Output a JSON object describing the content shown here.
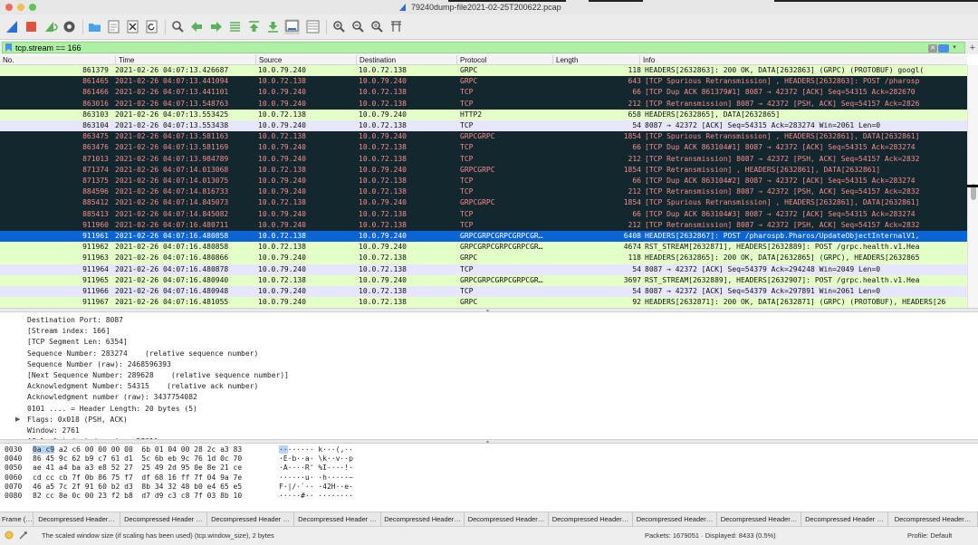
{
  "window": {
    "title": "79240dump-file2021-02-25T200622.pcap"
  },
  "toolbar": {
    "buttons": [
      "shark-fin-start-icon",
      "stop-icon",
      "restart-icon",
      "options-gear-icon",
      "open-folder-icon",
      "save-file-icon",
      "close-file-icon",
      "reload-icon",
      "find-magnifier-icon",
      "go-back-icon",
      "go-forward-icon",
      "go-to-packet-icon",
      "go-first-icon",
      "go-last-icon",
      "autoscroll-icon",
      "colorize-icon",
      "zoom-in-icon",
      "zoom-out-icon",
      "zoom-normal-icon",
      "resize-columns-icon"
    ]
  },
  "filter": {
    "value": "tcp.stream == 166",
    "clear_label": "✕",
    "plus_label": "+"
  },
  "packet_list": {
    "columns": [
      "No.",
      "Time",
      "Source",
      "Destination",
      "Protocol",
      "Length",
      "Info"
    ],
    "rows": [
      {
        "no": "861379",
        "time": "2021-02-26 04:07:13.426687",
        "src": "10.0.79.240",
        "dst": "10.0.72.138",
        "proto": "GRPC",
        "len": "118",
        "info": "HEADERS[2632863]: 200 OK, DATA[2632863] (GRPC) (PROTOBUF) googl(",
        "style": "green"
      },
      {
        "no": "861465",
        "time": "2021-02-26 04:07:13.441094",
        "src": "10.0.72.138",
        "dst": "10.0.79.240",
        "proto": "GRPC",
        "len": "643",
        "info": "[TCP Spurious Retransmission] , HEADERS[2632863]: POST /pharosp",
        "style": "dark"
      },
      {
        "no": "861466",
        "time": "2021-02-26 04:07:13.441101",
        "src": "10.0.79.240",
        "dst": "10.0.72.138",
        "proto": "TCP",
        "len": "66",
        "info": "[TCP Dup ACK 861379#1] 8087 → 42372 [ACK] Seq=54315 Ack=282670",
        "style": "dark"
      },
      {
        "no": "863016",
        "time": "2021-02-26 04:07:13.548763",
        "src": "10.0.79.240",
        "dst": "10.0.72.138",
        "proto": "TCP",
        "len": "212",
        "info": "[TCP Retransmission] 8087 → 42372 [PSH, ACK] Seq=54157 Ack=2826",
        "style": "dark"
      },
      {
        "no": "863103",
        "time": "2021-02-26 04:07:13.553425",
        "src": "10.0.72.138",
        "dst": "10.0.79.240",
        "proto": "HTTP2",
        "len": "658",
        "info": "HEADERS[2632865], DATA[2632865]",
        "style": "green"
      },
      {
        "no": "863104",
        "time": "2021-02-26 04:07:13.553438",
        "src": "10.0.79.240",
        "dst": "10.0.72.138",
        "proto": "TCP",
        "len": "54",
        "info": "8087 → 42372 [ACK] Seq=54315 Ack=283274 Win=2061 Len=0",
        "style": "lav"
      },
      {
        "no": "863475",
        "time": "2021-02-26 04:07:13.581163",
        "src": "10.0.72.138",
        "dst": "10.0.79.240",
        "proto": "GRPCGRPC",
        "len": "1854",
        "info": "[TCP Spurious Retransmission] , HEADERS[2632861], DATA[2632861]",
        "style": "dark"
      },
      {
        "no": "863476",
        "time": "2021-02-26 04:07:13.581169",
        "src": "10.0.79.240",
        "dst": "10.0.72.138",
        "proto": "TCP",
        "len": "66",
        "info": "[TCP Dup ACK 863104#1] 8087 → 42372 [ACK] Seq=54315 Ack=283274",
        "style": "dark"
      },
      {
        "no": "871013",
        "time": "2021-02-26 04:07:13.984789",
        "src": "10.0.79.240",
        "dst": "10.0.72.138",
        "proto": "TCP",
        "len": "212",
        "info": "[TCP Retransmission] 8087 → 42372 [PSH, ACK] Seq=54157 Ack=2832",
        "style": "dark"
      },
      {
        "no": "871374",
        "time": "2021-02-26 04:07:14.013068",
        "src": "10.0.72.138",
        "dst": "10.0.79.240",
        "proto": "GRPCGRPC",
        "len": "1854",
        "info": "[TCP Retransmission] , HEADERS[2632861], DATA[2632861]",
        "style": "dark"
      },
      {
        "no": "871375",
        "time": "2021-02-26 04:07:14.013075",
        "src": "10.0.79.240",
        "dst": "10.0.72.138",
        "proto": "TCP",
        "len": "66",
        "info": "[TCP Dup ACK 863104#2] 8087 → 42372 [ACK] Seq=54315 Ack=283274",
        "style": "dark"
      },
      {
        "no": "884596",
        "time": "2021-02-26 04:07:14.816733",
        "src": "10.0.79.240",
        "dst": "10.0.72.138",
        "proto": "TCP",
        "len": "212",
        "info": "[TCP Retransmission] 8087 → 42372 [PSH, ACK] Seq=54157 Ack=2832",
        "style": "dark"
      },
      {
        "no": "885412",
        "time": "2021-02-26 04:07:14.845073",
        "src": "10.0.72.138",
        "dst": "10.0.79.240",
        "proto": "GRPCGRPC",
        "len": "1854",
        "info": "[TCP Spurious Retransmission] , HEADERS[2632861], DATA[2632861]",
        "style": "dark"
      },
      {
        "no": "885413",
        "time": "2021-02-26 04:07:14.845082",
        "src": "10.0.79.240",
        "dst": "10.0.72.138",
        "proto": "TCP",
        "len": "66",
        "info": "[TCP Dup ACK 863104#3] 8087 → 42372 [ACK] Seq=54315 Ack=283274",
        "style": "dark"
      },
      {
        "no": "911960",
        "time": "2021-02-26 04:07:16.480711",
        "src": "10.0.79.240",
        "dst": "10.0.72.138",
        "proto": "TCP",
        "len": "212",
        "info": "[TCP Retransmission] 8087 → 42372 [PSH, ACK] Seq=54157 Ack=2832",
        "style": "dark"
      },
      {
        "no": "911961",
        "time": "2021-02-26 04:07:16.480858",
        "src": "10.0.72.138",
        "dst": "10.0.79.240",
        "proto": "GRPCGRPCGRPCGRPCGR…",
        "len": "6408",
        "info": "HEADERS[2632867]: POST /pharospb.Pharos/UpdateObjectInternalV1,",
        "style": "sel"
      },
      {
        "no": "911962",
        "time": "2021-02-26 04:07:16.480858",
        "src": "10.0.72.138",
        "dst": "10.0.79.240",
        "proto": "GRPCGRPCGRPCGRPCGR…",
        "len": "4674",
        "info": "RST_STREAM[2632871], HEADERS[2632889]: POST /grpc.health.v1.Hea",
        "style": "green"
      },
      {
        "no": "911963",
        "time": "2021-02-26 04:07:16.480866",
        "src": "10.0.79.240",
        "dst": "10.0.72.138",
        "proto": "GRPC",
        "len": "118",
        "info": "HEADERS[2632865]: 200 OK, DATA[2632865] (GRPC), HEADERS[2632865",
        "style": "green"
      },
      {
        "no": "911964",
        "time": "2021-02-26 04:07:16.480878",
        "src": "10.0.79.240",
        "dst": "10.0.72.138",
        "proto": "TCP",
        "len": "54",
        "info": "8087 → 42372 [ACK] Seq=54379 Ack=294248 Win=2049 Len=0",
        "style": "lav"
      },
      {
        "no": "911965",
        "time": "2021-02-26 04:07:16.480940",
        "src": "10.0.72.138",
        "dst": "10.0.79.240",
        "proto": "GRPCGRPCGRPCGRPCGR…",
        "len": "3697",
        "info": "RST_STREAM[2632889], HEADERS[2632907]: POST /grpc.health.v1.Hea",
        "style": "green"
      },
      {
        "no": "911966",
        "time": "2021-02-26 04:07:16.480948",
        "src": "10.0.79.240",
        "dst": "10.0.72.138",
        "proto": "TCP",
        "len": "54",
        "info": "8087 → 42372 [ACK] Seq=54379 Ack=297891 Win=2061 Len=0",
        "style": "lav"
      },
      {
        "no": "911967",
        "time": "2021-02-26 04:07:16.481055",
        "src": "10.0.79.240",
        "dst": "10.0.72.138",
        "proto": "GRPC",
        "len": "92",
        "info": "HEADERS[2632871]: 200 OK, DATA[2632871] (GRPC) (PROTOBUF), HEADERS[26",
        "style": "green"
      }
    ]
  },
  "details": {
    "lines": [
      {
        "text": "Destination Port: 8087",
        "tri": ""
      },
      {
        "text": "[Stream index: 166]",
        "tri": ""
      },
      {
        "text": "[TCP Segment Len: 6354]",
        "tri": ""
      },
      {
        "text": "Sequence Number: 283274    (relative sequence number)",
        "tri": ""
      },
      {
        "text": "Sequence Number (raw): 2468596393",
        "tri": ""
      },
      {
        "text": "[Next Sequence Number: 289628    (relative sequence number)]",
        "tri": ""
      },
      {
        "text": "Acknowledgment Number: 54315    (relative ack number)",
        "tri": ""
      },
      {
        "text": "Acknowledgment number (raw): 3437754082",
        "tri": ""
      },
      {
        "text": "0101 .... = Header Length: 20 bytes (5)",
        "tri": ""
      },
      {
        "text": "Flags: 0x018 (PSH, ACK)",
        "tri": "▶"
      },
      {
        "text": "Window: 2761",
        "tri": ""
      },
      {
        "text": "[Calculated window size: 2761]",
        "tri": ""
      }
    ]
  },
  "bytes": {
    "lines": [
      {
        "off": "0030",
        "hex_hl": "0a c9",
        "hex": " a2 c6 00 00 00 00  6b 01 04 00 28 2c a3 83",
        "asc_hl": "··",
        "asc": "······ k···(,··"
      },
      {
        "off": "0040",
        "hex_hl": "",
        "hex": "86 45 9c 62 b9 c7 61 d1  5c 6b eb 9c 76 1d 0c 70",
        "asc_hl": "",
        "asc": "·E·b··a· \\k··v··p"
      },
      {
        "off": "0050",
        "hex_hl": "",
        "hex": "ae 41 a4 ba a3 e8 52 27  25 49 2d 95 0e 8e 21 ce",
        "asc_hl": "",
        "asc": "·A····R' %I-···!·"
      },
      {
        "off": "0060",
        "hex_hl": "",
        "hex": "cd cc cb 7f 0b 86 75 f7  df 68 16 ff 7f 04 9a 7e",
        "asc_hl": "",
        "asc": "······u· ·h·····~"
      },
      {
        "off": "0070",
        "hex_hl": "",
        "hex": "46 a5 7c 2f 91 60 b2 d3  8b 34 32 48 b0 e4 65 e5",
        "asc_hl": "",
        "asc": "F·|/·`·· ·42H··e·"
      },
      {
        "off": "0080",
        "hex_hl": "",
        "hex": "82 cc 8e 0c 00 23 f2 b8  d7 d9 c3 c8 7f 03 8b 10",
        "asc_hl": "",
        "asc": "·····#·· ········"
      }
    ]
  },
  "tabs": [
    "Frame (…",
    "Decompressed Header…",
    "Decompressed Header …",
    "Decompressed Header …",
    "Decompressed Header …",
    "Decompressed Header…",
    "Decompressed Header…",
    "Decompressed Header…",
    "Decompressed Header…",
    "Decompressed Header…",
    "Decompressed Header …",
    "Decompressed Header…"
  ],
  "status": {
    "field_text": "The scaled window size (if scaling has been used) (tcp.window_size), 2 bytes",
    "packets_text": "Packets: 1679051 · Displayed: 8433 (0.5%)",
    "profile_text": "Profile: Default"
  },
  "colors": {
    "dark_row_bg": "#12272e",
    "dark_row_fg": "#f78c8c",
    "green_row_bg": "#e4ffc7",
    "lavender_row_bg": "#e7e6ff",
    "selected_row_bg": "#0a64d6",
    "filter_bg": "#aef0a5"
  }
}
